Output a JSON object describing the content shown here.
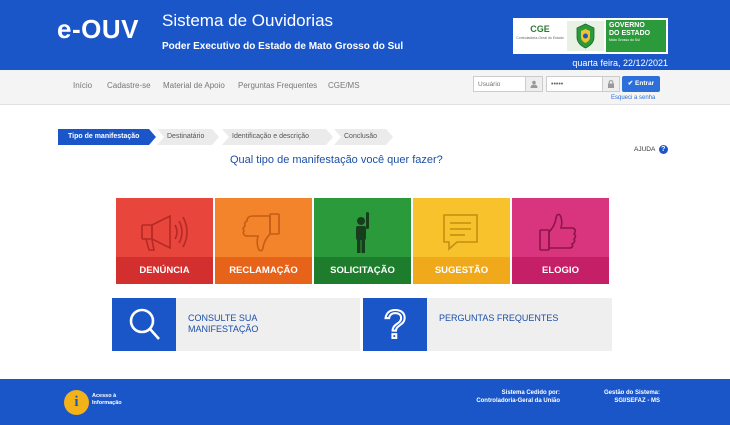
{
  "header": {
    "logo": "e-OUV",
    "title": "Sistema de Ouvidorias",
    "subtitle": "Poder Executivo do Estado de Mato Grosso do Sul",
    "cge_label": "CGE",
    "cge_sub": "Controladoria-Geral do Estado",
    "gov_title_1": "GOVERNO",
    "gov_title_2": "DO ESTADO",
    "gov_sub": "Mato Grosso do Sul",
    "date": "quarta feira, 22/12/2021",
    "bg_color": "#1b56c9"
  },
  "nav": {
    "items": [
      "Início",
      "Cadastre-se",
      "Material de Apoio",
      "Perguntas Frequentes",
      "CGE/MS"
    ]
  },
  "login": {
    "user_placeholder": "Usuário",
    "password_value": "•••••",
    "enter_label": "✔ Entrar",
    "forgot_label": "Esqueci a senha"
  },
  "steps": [
    "Tipo de manifestação",
    "Destinatário",
    "Identificação e descrição",
    "Conclusão"
  ],
  "help_label": "AJUDA",
  "question": "Qual tipo de manifestação você quer fazer?",
  "tiles": [
    {
      "label": "DENÚNCIA",
      "icon": "megaphone-icon",
      "color": "#e8453c",
      "dark": "#d32f2f"
    },
    {
      "label": "RECLAMAÇÃO",
      "icon": "thumbs-down-icon",
      "color": "#f4842b",
      "dark": "#e8631a"
    },
    {
      "label": "SOLICITAÇÃO",
      "icon": "raised-hand-person-icon",
      "color": "#2b9a3a",
      "dark": "#1d7d2c"
    },
    {
      "label": "SUGESTÃO",
      "icon": "speech-bubble-icon",
      "color": "#f7c22c",
      "dark": "#f0a91b"
    },
    {
      "label": "ELOGIO",
      "icon": "thumbs-up-icon",
      "color": "#d8357e",
      "dark": "#c51f68"
    }
  ],
  "cards": [
    {
      "label": "CONSULTE SUA MANIFESTAÇÃO",
      "icon": "search-icon"
    },
    {
      "label": "PERGUNTAS FREQUENTES",
      "icon": "question-mark-icon"
    }
  ],
  "footer": {
    "info_label": "Acesso à Informação",
    "ceded_label": "Sistema Cedido por:",
    "ceded_value": "Controladoria-Geral da União",
    "mgmt_label": "Gestão do Sistema:",
    "mgmt_value": "SGI/SEFAZ - MS"
  }
}
